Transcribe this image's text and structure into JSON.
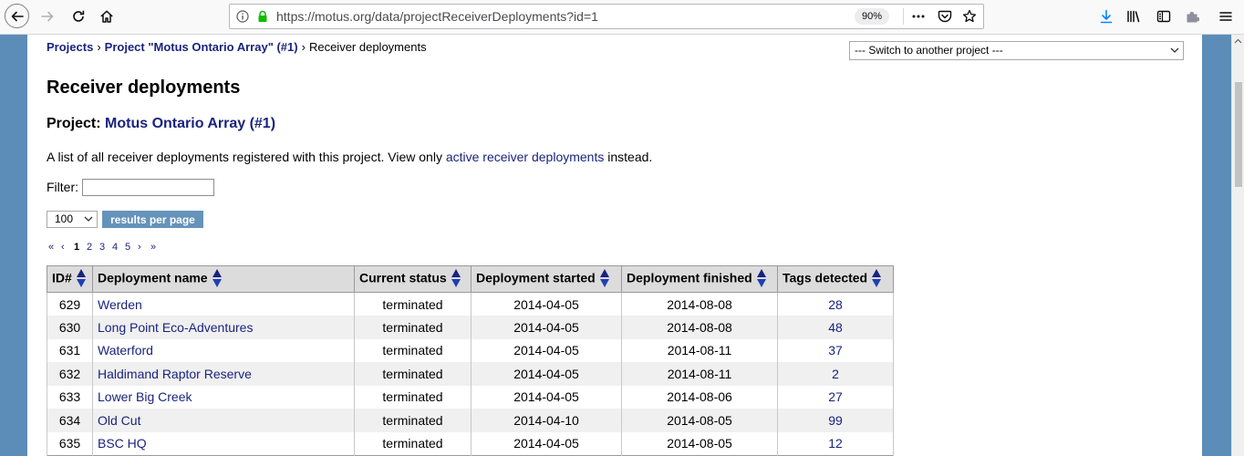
{
  "browser": {
    "url": "https://motus.org/data/projectReceiverDeployments?id=1",
    "zoom": "90%"
  },
  "icons": {
    "toolbar_left": [
      "back-arrow-icon",
      "forward-arrow-icon",
      "reload-icon",
      "home-icon"
    ],
    "urlbar": [
      "info-icon",
      "lock-icon",
      "page-actions-icon",
      "pocket-icon",
      "bookmark-star-icon"
    ],
    "toolbar_right": [
      "download-icon",
      "library-icon",
      "sidebar-icon",
      "extension-icon",
      "menu-icon"
    ],
    "page": [
      "chevron-down-icon",
      "sort-arrows-icon",
      "scroll-up-icon"
    ]
  },
  "colors": {
    "link": "#1a237e",
    "page_background": "#5b8db8",
    "button": "#6593ba",
    "table_header": "#dcdcdc",
    "row_alt": "#f0f0f0",
    "download_icon": "#0a84ff",
    "secure_lock": "#12bc00"
  },
  "breadcrumb": {
    "projects": "Projects",
    "separator": "›",
    "project": "Project \"Motus Ontario Array\" (#1)",
    "current": "Receiver deployments"
  },
  "project_switcher": {
    "selected": "--- Switch to another project ---"
  },
  "heading": "Receiver deployments",
  "project_line": {
    "label": "Project:",
    "name": "Motus Ontario Array (#1)"
  },
  "intro": {
    "before": "A list of all receiver deployments registered with this project. View only ",
    "link": "active receiver deployments",
    "after": " instead."
  },
  "filter": {
    "label": "Filter:",
    "value": ""
  },
  "per_page": {
    "selected": "100",
    "button": "results per page"
  },
  "pagination": {
    "first": "«",
    "prev": "‹",
    "current": "1",
    "other_pages": [
      "2",
      "3",
      "4",
      "5"
    ],
    "next": "›",
    "last": "»"
  },
  "table": {
    "columns": [
      "ID#",
      "Deployment name",
      "Current status",
      "Deployment started",
      "Deployment finished",
      "Tags detected"
    ],
    "rows": [
      {
        "id": "629",
        "name": "Werden",
        "status": "terminated",
        "started": "2014-04-05",
        "finished": "2014-08-08",
        "tags": "28"
      },
      {
        "id": "630",
        "name": "Long Point Eco-Adventures",
        "status": "terminated",
        "started": "2014-04-05",
        "finished": "2014-08-08",
        "tags": "48"
      },
      {
        "id": "631",
        "name": "Waterford",
        "status": "terminated",
        "started": "2014-04-05",
        "finished": "2014-08-11",
        "tags": "37"
      },
      {
        "id": "632",
        "name": "Haldimand Raptor Reserve",
        "status": "terminated",
        "started": "2014-04-05",
        "finished": "2014-08-11",
        "tags": "2"
      },
      {
        "id": "633",
        "name": "Lower Big Creek",
        "status": "terminated",
        "started": "2014-04-05",
        "finished": "2014-08-06",
        "tags": "27"
      },
      {
        "id": "634",
        "name": "Old Cut",
        "status": "terminated",
        "started": "2014-04-10",
        "finished": "2014-08-05",
        "tags": "99"
      },
      {
        "id": "635",
        "name": "BSC HQ",
        "status": "terminated",
        "started": "2014-04-05",
        "finished": "2014-08-05",
        "tags": "12"
      }
    ]
  }
}
